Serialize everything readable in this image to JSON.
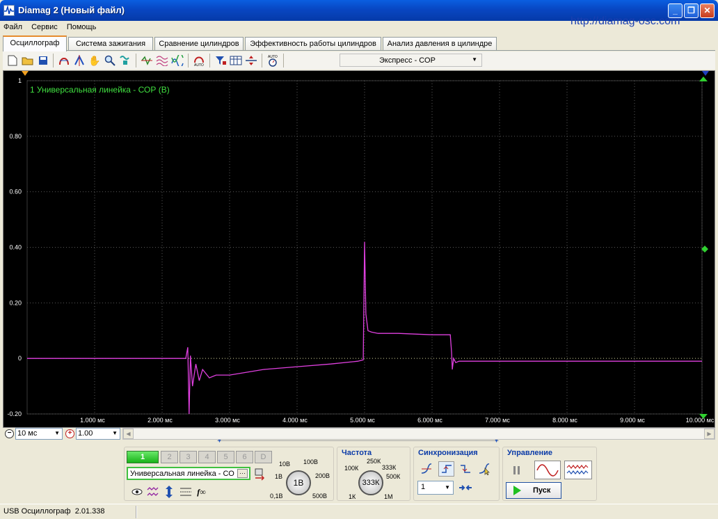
{
  "window": {
    "title": "Diamag 2 (Новый файл)",
    "url": "http://diamag-osc.com"
  },
  "menu": [
    "Файл",
    "Сервис",
    "Помощь"
  ],
  "tabs": [
    "Осциллограф",
    "Система зажигания",
    "Сравнение цилиндров",
    "Эффективность работы цилиндров",
    "Анализ давления в цилиндре"
  ],
  "toolbar": {
    "preset": "Экспресс - СОР"
  },
  "chart_data": {
    "type": "line",
    "title": "1 Универсальная линейка - СОР (В)",
    "xlim": [
      0,
      10.0
    ],
    "ylim": [
      -0.22,
      1.0
    ],
    "x_ticks": [
      "1.000 мс",
      "2.000 мс",
      "3.000 мс",
      "4.000 мс",
      "5.000 мс",
      "6.000 мс",
      "7.000 мс",
      "8.000 мс",
      "9.000 мс",
      "10.000 мс"
    ],
    "y_ticks": [
      "1",
      "0.80",
      "0.60",
      "0.40",
      "0.20",
      "0",
      "-0.20"
    ],
    "grid": true,
    "series": [
      {
        "color": "#e040e0",
        "x": [
          0,
          0.5,
          1.0,
          1.5,
          2.0,
          2.35,
          2.38,
          2.4,
          2.42,
          2.45,
          2.5,
          2.55,
          2.6,
          2.7,
          2.8,
          3.0,
          3.5,
          4.0,
          4.5,
          4.9,
          4.98,
          5.0,
          5.02,
          5.05,
          5.1,
          5.2,
          5.5,
          6.0,
          6.27,
          6.29,
          6.3,
          6.32,
          6.35,
          6.4,
          6.5,
          7.0,
          8.0,
          9.0,
          10.0
        ],
        "y": [
          0,
          0,
          0,
          0,
          0,
          0,
          0.04,
          -0.2,
          0.01,
          -0.1,
          -0.02,
          -0.08,
          -0.04,
          -0.07,
          -0.06,
          -0.06,
          -0.04,
          -0.03,
          -0.02,
          -0.01,
          -0.005,
          0.42,
          0.16,
          0.1,
          0.095,
          0.09,
          0.09,
          0.085,
          0.085,
          0.02,
          -0.04,
          0.0,
          -0.015,
          -0.01,
          -0.01,
          -0.01,
          -0.01,
          -0.01,
          -0.01
        ]
      }
    ]
  },
  "zoom": {
    "time_div": "10 мс",
    "gain": "1.00"
  },
  "channels": {
    "buttons": [
      "1",
      "2",
      "3",
      "4",
      "5",
      "6",
      "D"
    ],
    "sensor": "Универсальная линейка - СО",
    "range_labels": [
      "10В",
      "100В",
      "1В",
      "200В",
      "0,1В",
      "500В"
    ],
    "range_value": "1В"
  },
  "freq": {
    "title": "Частота",
    "labels": [
      "250К",
      "100К",
      "333К",
      "500К",
      "1К",
      "1М"
    ],
    "value": "333К"
  },
  "sync": {
    "title": "Синхронизация",
    "channel": "1"
  },
  "control": {
    "title": "Управление",
    "run": "Пуск"
  },
  "status": {
    "device": "USB Осциллограф",
    "version": "2.01.338"
  }
}
